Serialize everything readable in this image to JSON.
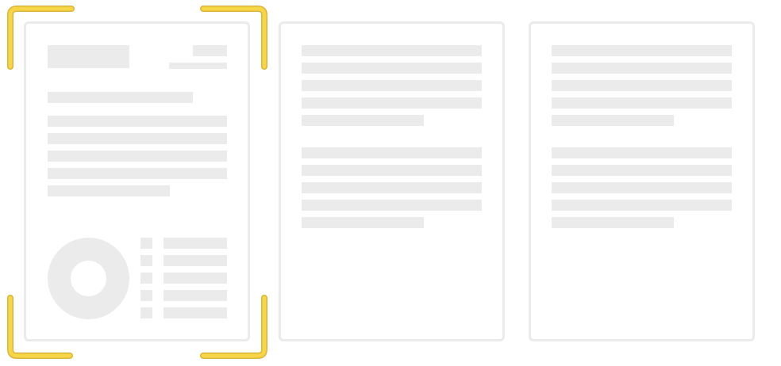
{
  "thumbnails": [
    {
      "id": "page-1",
      "selected": true,
      "kind": "report-with-chart"
    },
    {
      "id": "page-2",
      "selected": false,
      "kind": "text-only"
    },
    {
      "id": "page-3",
      "selected": false,
      "kind": "text-only"
    }
  ],
  "colors": {
    "placeholder": "#ebebeb",
    "page_border": "#ebebeb",
    "selection": "#f6d548",
    "selection_outline": "#dcb63a",
    "background": "#ffffff"
  }
}
